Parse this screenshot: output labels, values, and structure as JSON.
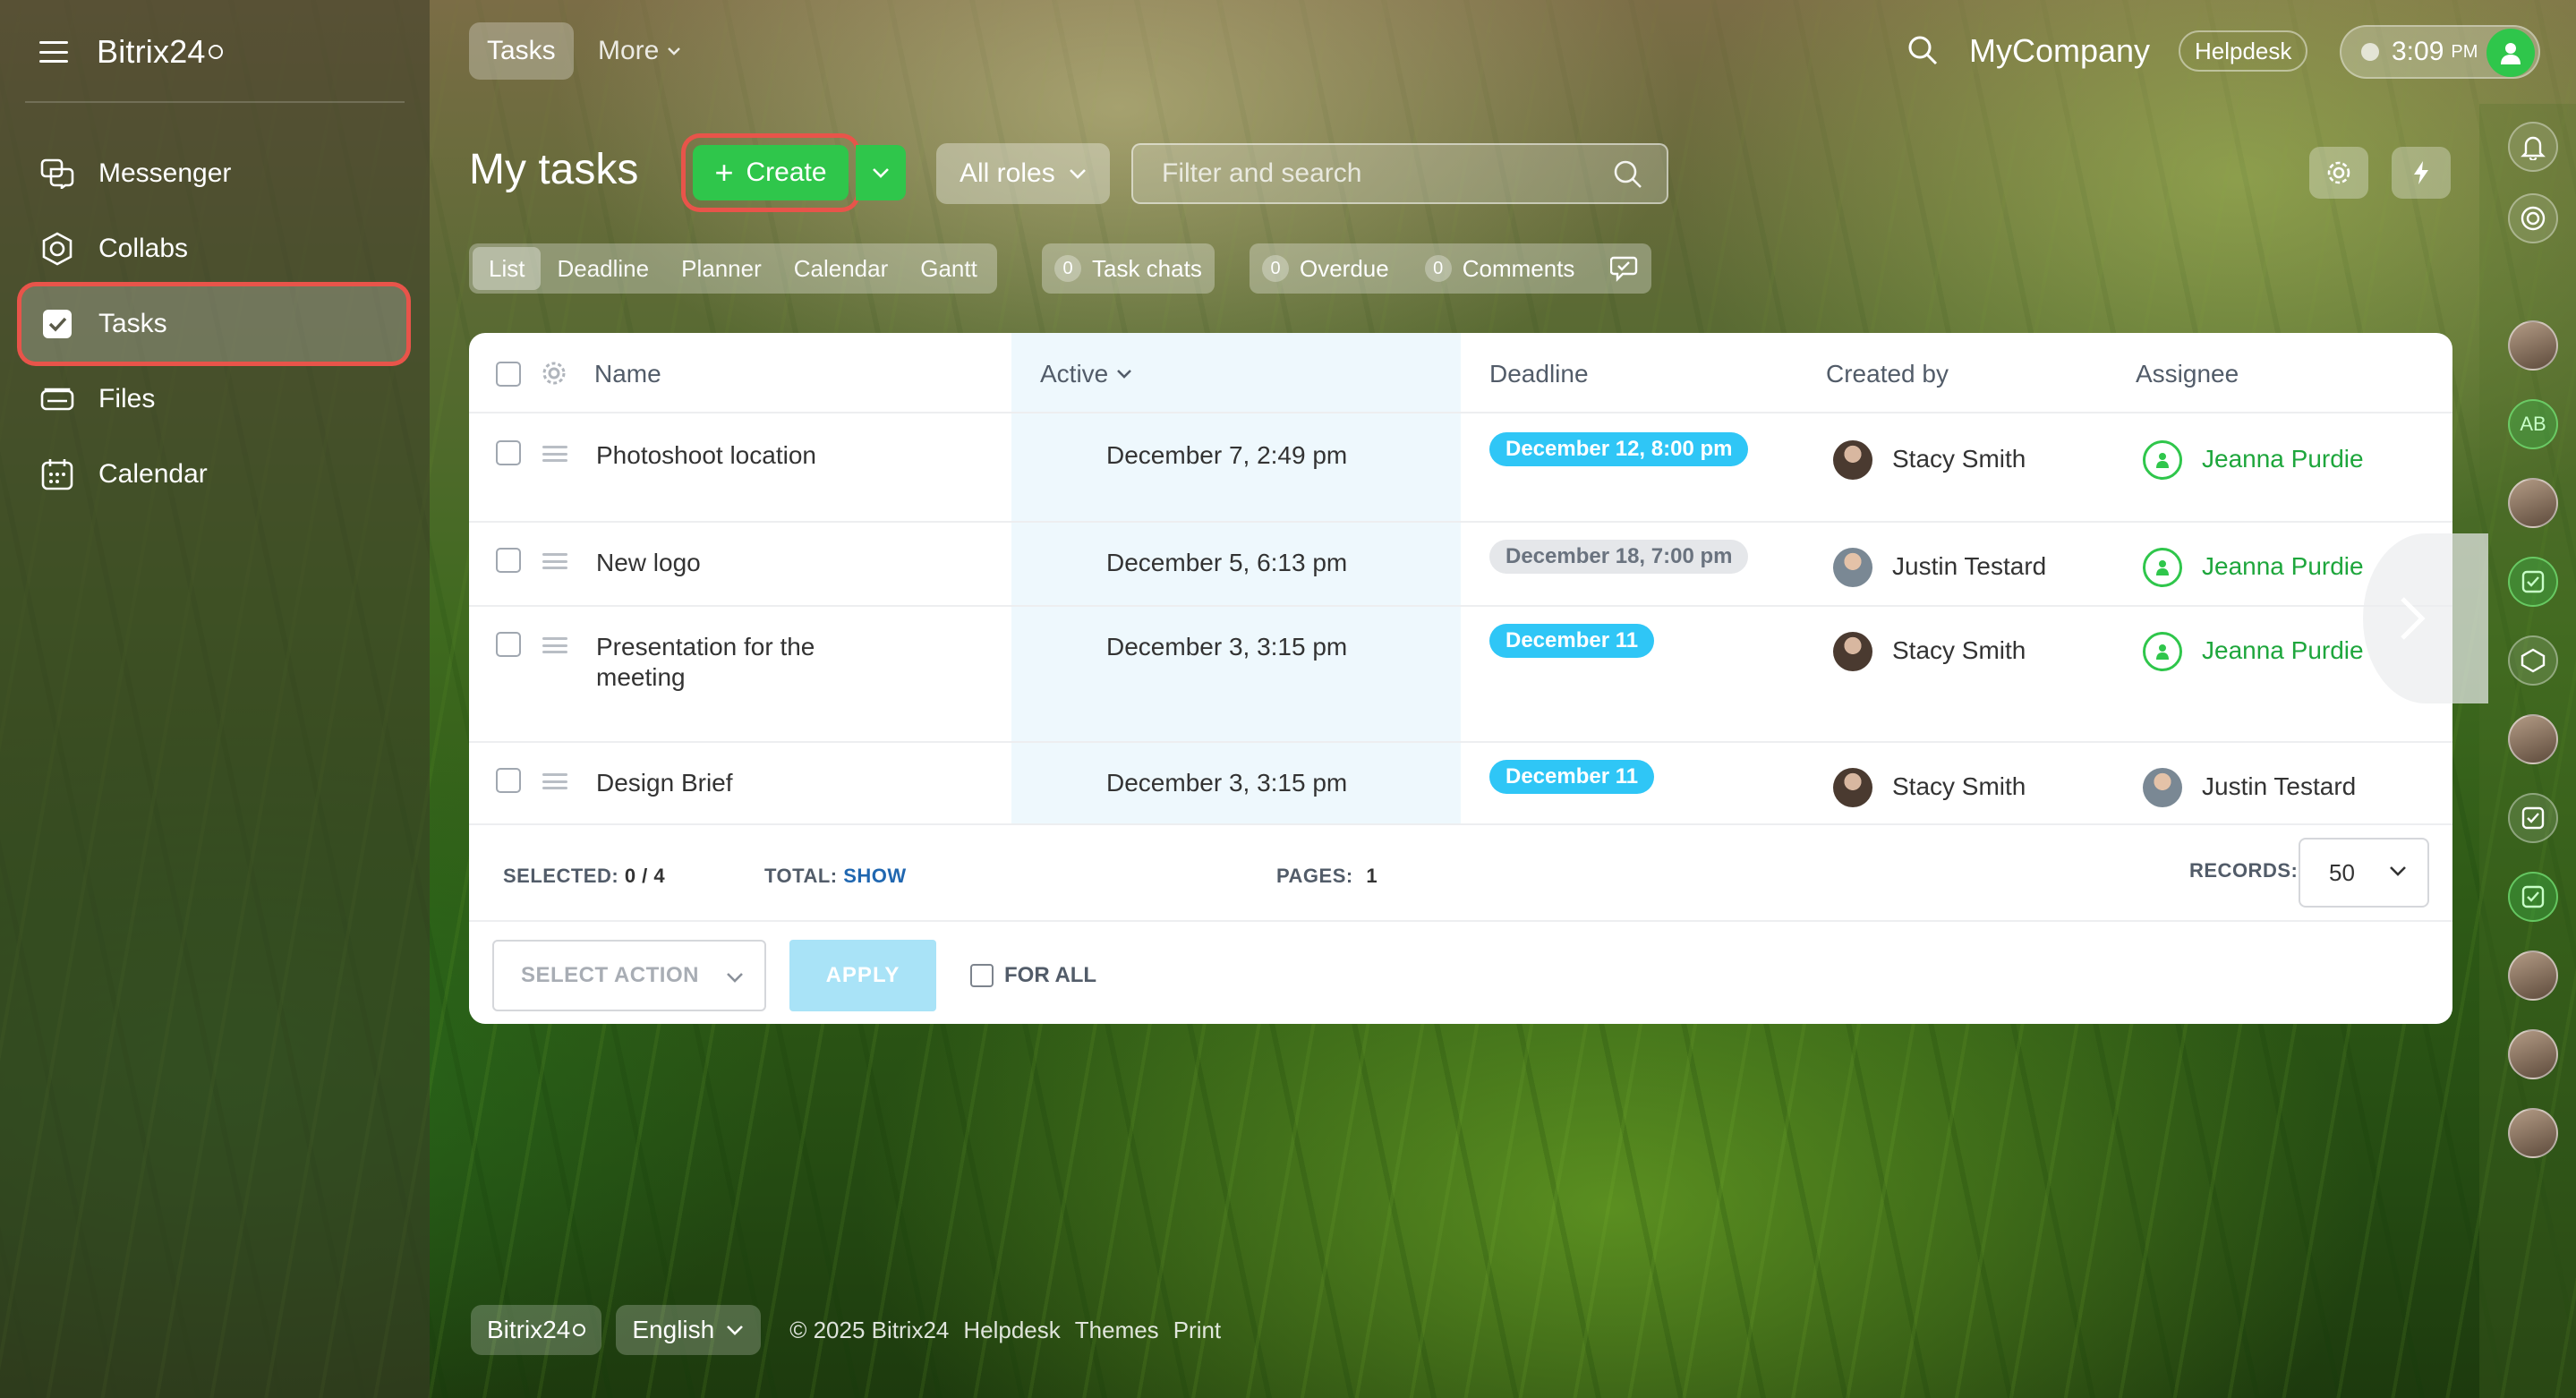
{
  "sidebar": {
    "brand": "Bitrix24",
    "items": [
      {
        "label": "Messenger",
        "icon": "messenger-icon"
      },
      {
        "label": "Collabs",
        "icon": "collabs-icon"
      },
      {
        "label": "Tasks",
        "icon": "tasks-icon",
        "active": true
      },
      {
        "label": "Files",
        "icon": "files-icon"
      },
      {
        "label": "Calendar",
        "icon": "calendar-icon"
      }
    ]
  },
  "topbar": {
    "tab_tasks": "Tasks",
    "tab_more": "More",
    "company": "MyCompany",
    "helpdesk": "Helpdesk",
    "time": "3:09",
    "ampm": "PM"
  },
  "header": {
    "title": "My tasks",
    "create_label": "Create",
    "roles_label": "All roles",
    "filter_placeholder": "Filter and search"
  },
  "view_tabs": [
    "List",
    "Deadline",
    "Planner",
    "Calendar",
    "Gantt"
  ],
  "counters": {
    "task_chats": {
      "count": "0",
      "label": "Task chats"
    },
    "overdue": {
      "count": "0",
      "label": "Overdue"
    },
    "comments": {
      "count": "0",
      "label": "Comments"
    }
  },
  "table": {
    "columns": {
      "name": "Name",
      "active": "Active",
      "deadline": "Deadline",
      "created_by": "Created by",
      "assignee": "Assignee"
    },
    "rows": [
      {
        "name": "Photoshoot location",
        "active": "December 7, 2:49 pm",
        "deadline": "December 12, 8:00 pm",
        "created_by": "Stacy Smith",
        "assignee": "Jeanna Purdie"
      },
      {
        "name": "New logo",
        "active": "December 5, 6:13 pm",
        "deadline": "December 18, 7:00 pm",
        "created_by": "Justin Testard",
        "assignee": "Jeanna Purdie"
      },
      {
        "name_line1": "Presentation for the",
        "name_line2": "meeting",
        "active": "December 3, 3:15 pm",
        "deadline": "December 11",
        "created_by": "Stacy Smith",
        "assignee": "Jeanna Purdie"
      },
      {
        "name": "Design Brief",
        "active": "December 3, 3:15 pm",
        "deadline": "December 11",
        "created_by": "Stacy Smith",
        "assignee": "Justin Testard"
      }
    ]
  },
  "table_footer": {
    "selected_label": "SELECTED:",
    "selected_value": "0 / 4",
    "total_label": "TOTAL:",
    "total_link": "SHOW",
    "pages_label": "PAGES:",
    "pages_value": "1",
    "records_label": "RECORDS:",
    "records_value": "50",
    "select_action": "SELECT ACTION",
    "apply": "APPLY",
    "for_all": "FOR ALL"
  },
  "footer": {
    "brand": "Bitrix24",
    "language": "English",
    "copyright": "© 2025 Bitrix24",
    "helpdesk": "Helpdesk",
    "themes": "Themes",
    "print": "Print"
  },
  "colors": {
    "accent_green": "#2fc64b",
    "deadline_blue": "#2fc6f6",
    "highlight_red": "#e8544a"
  }
}
